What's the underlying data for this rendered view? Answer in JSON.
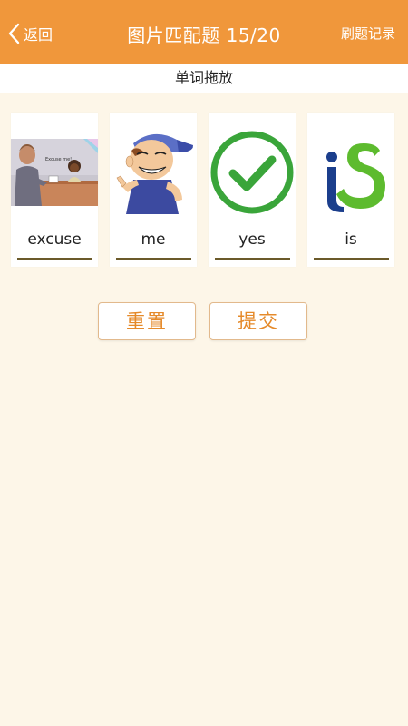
{
  "header": {
    "back_label": "返回",
    "title": "图片匹配题 15/20",
    "record_label": "刷题记录"
  },
  "subheader": {
    "label": "单词拖放"
  },
  "cards": [
    {
      "word": "excuse",
      "image": "excuse-me-illustration",
      "caption_in_image": "Excuse me!"
    },
    {
      "word": "me",
      "image": "boy-pointing-self-illustration"
    },
    {
      "word": "yes",
      "image": "green-checkmark-icon"
    },
    {
      "word": "is",
      "image": "is-logo",
      "logo_text": "iS"
    }
  ],
  "buttons": {
    "reset_label": "重置",
    "submit_label": "提交"
  },
  "colors": {
    "header_bg": "#f0973b",
    "page_bg": "#fdf6e8",
    "button_text": "#e58a2a",
    "underline": "#6b5a2a",
    "check_green": "#3aa53a",
    "logo_blue": "#1b3e8c",
    "logo_green": "#5dbb2e"
  }
}
